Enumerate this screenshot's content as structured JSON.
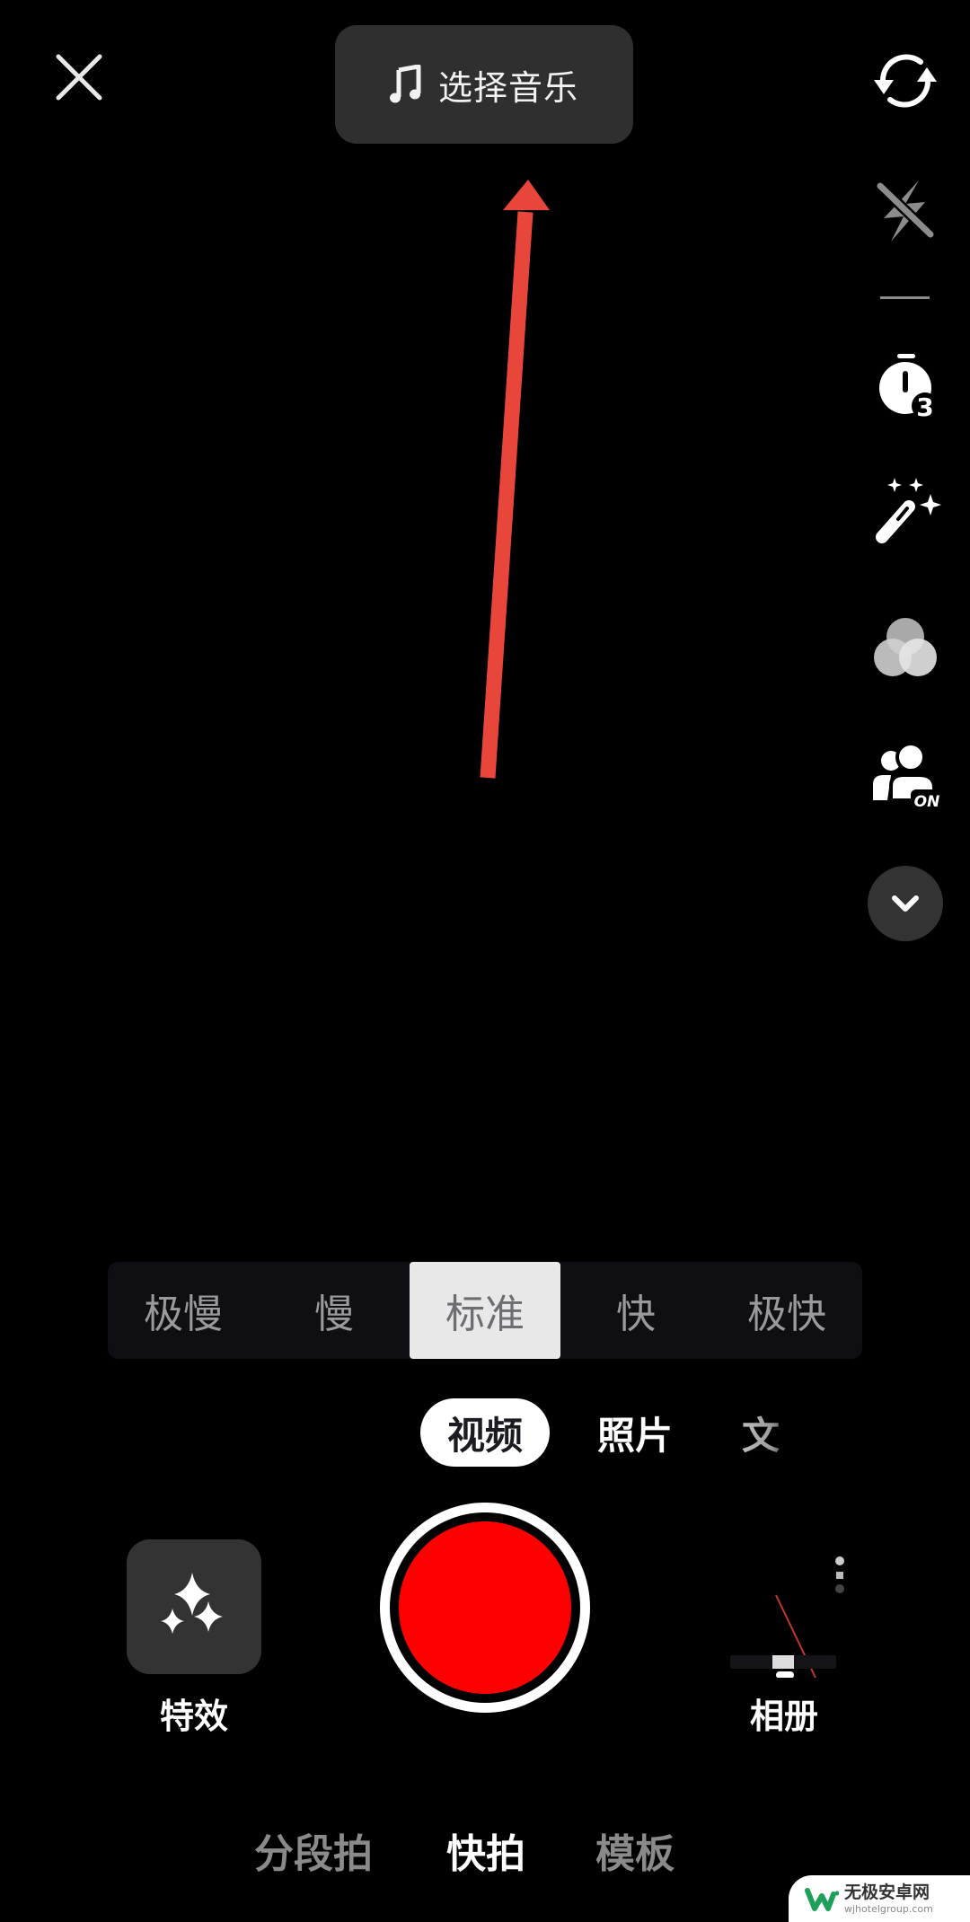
{
  "top_bar": {
    "close_icon": "close-icon",
    "music_button": {
      "icon": "music-note-icon",
      "label": "选择音乐"
    },
    "flip_icon": "flip-camera-icon"
  },
  "right_rail": [
    {
      "name": "flash-off",
      "icon": "flash-off-icon",
      "state": "off"
    },
    {
      "name": "timer",
      "icon": "timer-icon",
      "badge": "3"
    },
    {
      "name": "beautify",
      "icon": "magic-wand-icon"
    },
    {
      "name": "filters",
      "icon": "filter-circles-icon"
    },
    {
      "name": "multi-person",
      "icon": "users-icon",
      "badge": "ON"
    },
    {
      "name": "more",
      "icon": "chevron-down-icon"
    }
  ],
  "annotation": {
    "type": "arrow",
    "color": "#e8463a",
    "points_to": "music_button"
  },
  "speed_bar": {
    "options": [
      "极慢",
      "慢",
      "标准",
      "快",
      "极快"
    ],
    "selected_index": 2
  },
  "mode_tabs": {
    "items": [
      "视频",
      "照片",
      "文"
    ],
    "selected_index": 0
  },
  "capture_row": {
    "effects": {
      "label": "特效",
      "icon": "sparkles-icon"
    },
    "record": {
      "color": "#fe0000"
    },
    "album": {
      "label": "相册"
    }
  },
  "album_thumbnail": {
    "speed_options": [
      "极慢",
      "慢",
      "标准",
      "快",
      "极快"
    ],
    "mode_items": [
      "视频",
      "照片",
      "文"
    ]
  },
  "bottom_tabs": {
    "items": [
      "分段拍",
      "快拍",
      "模板"
    ],
    "selected_index": 1
  },
  "watermark": {
    "title": "无极安卓网",
    "url": "wjhotelgroup.com"
  }
}
